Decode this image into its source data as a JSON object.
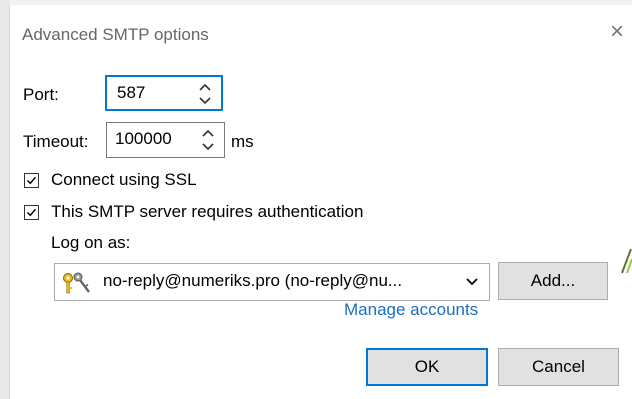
{
  "dialog": {
    "title": "Advanced SMTP options",
    "close_glyph": "×"
  },
  "port": {
    "label": "Port:",
    "value": "587"
  },
  "timeout": {
    "label": "Timeout:",
    "value": "100000",
    "unit": "ms"
  },
  "ssl": {
    "label": "Connect using SSL",
    "checked": true
  },
  "auth": {
    "label": "This SMTP server requires authentication",
    "checked": true
  },
  "logon": {
    "label": "Log on as:",
    "selected_account": "no-reply@numeriks.pro (no-reply@nu...",
    "icon": "keys-icon"
  },
  "buttons": {
    "add": "Add...",
    "manage": "Manage accounts",
    "ok": "OK",
    "cancel": "Cancel"
  },
  "colors": {
    "accent": "#0078d7",
    "link": "#1a6fc0",
    "button_face": "#e1e1e1"
  }
}
